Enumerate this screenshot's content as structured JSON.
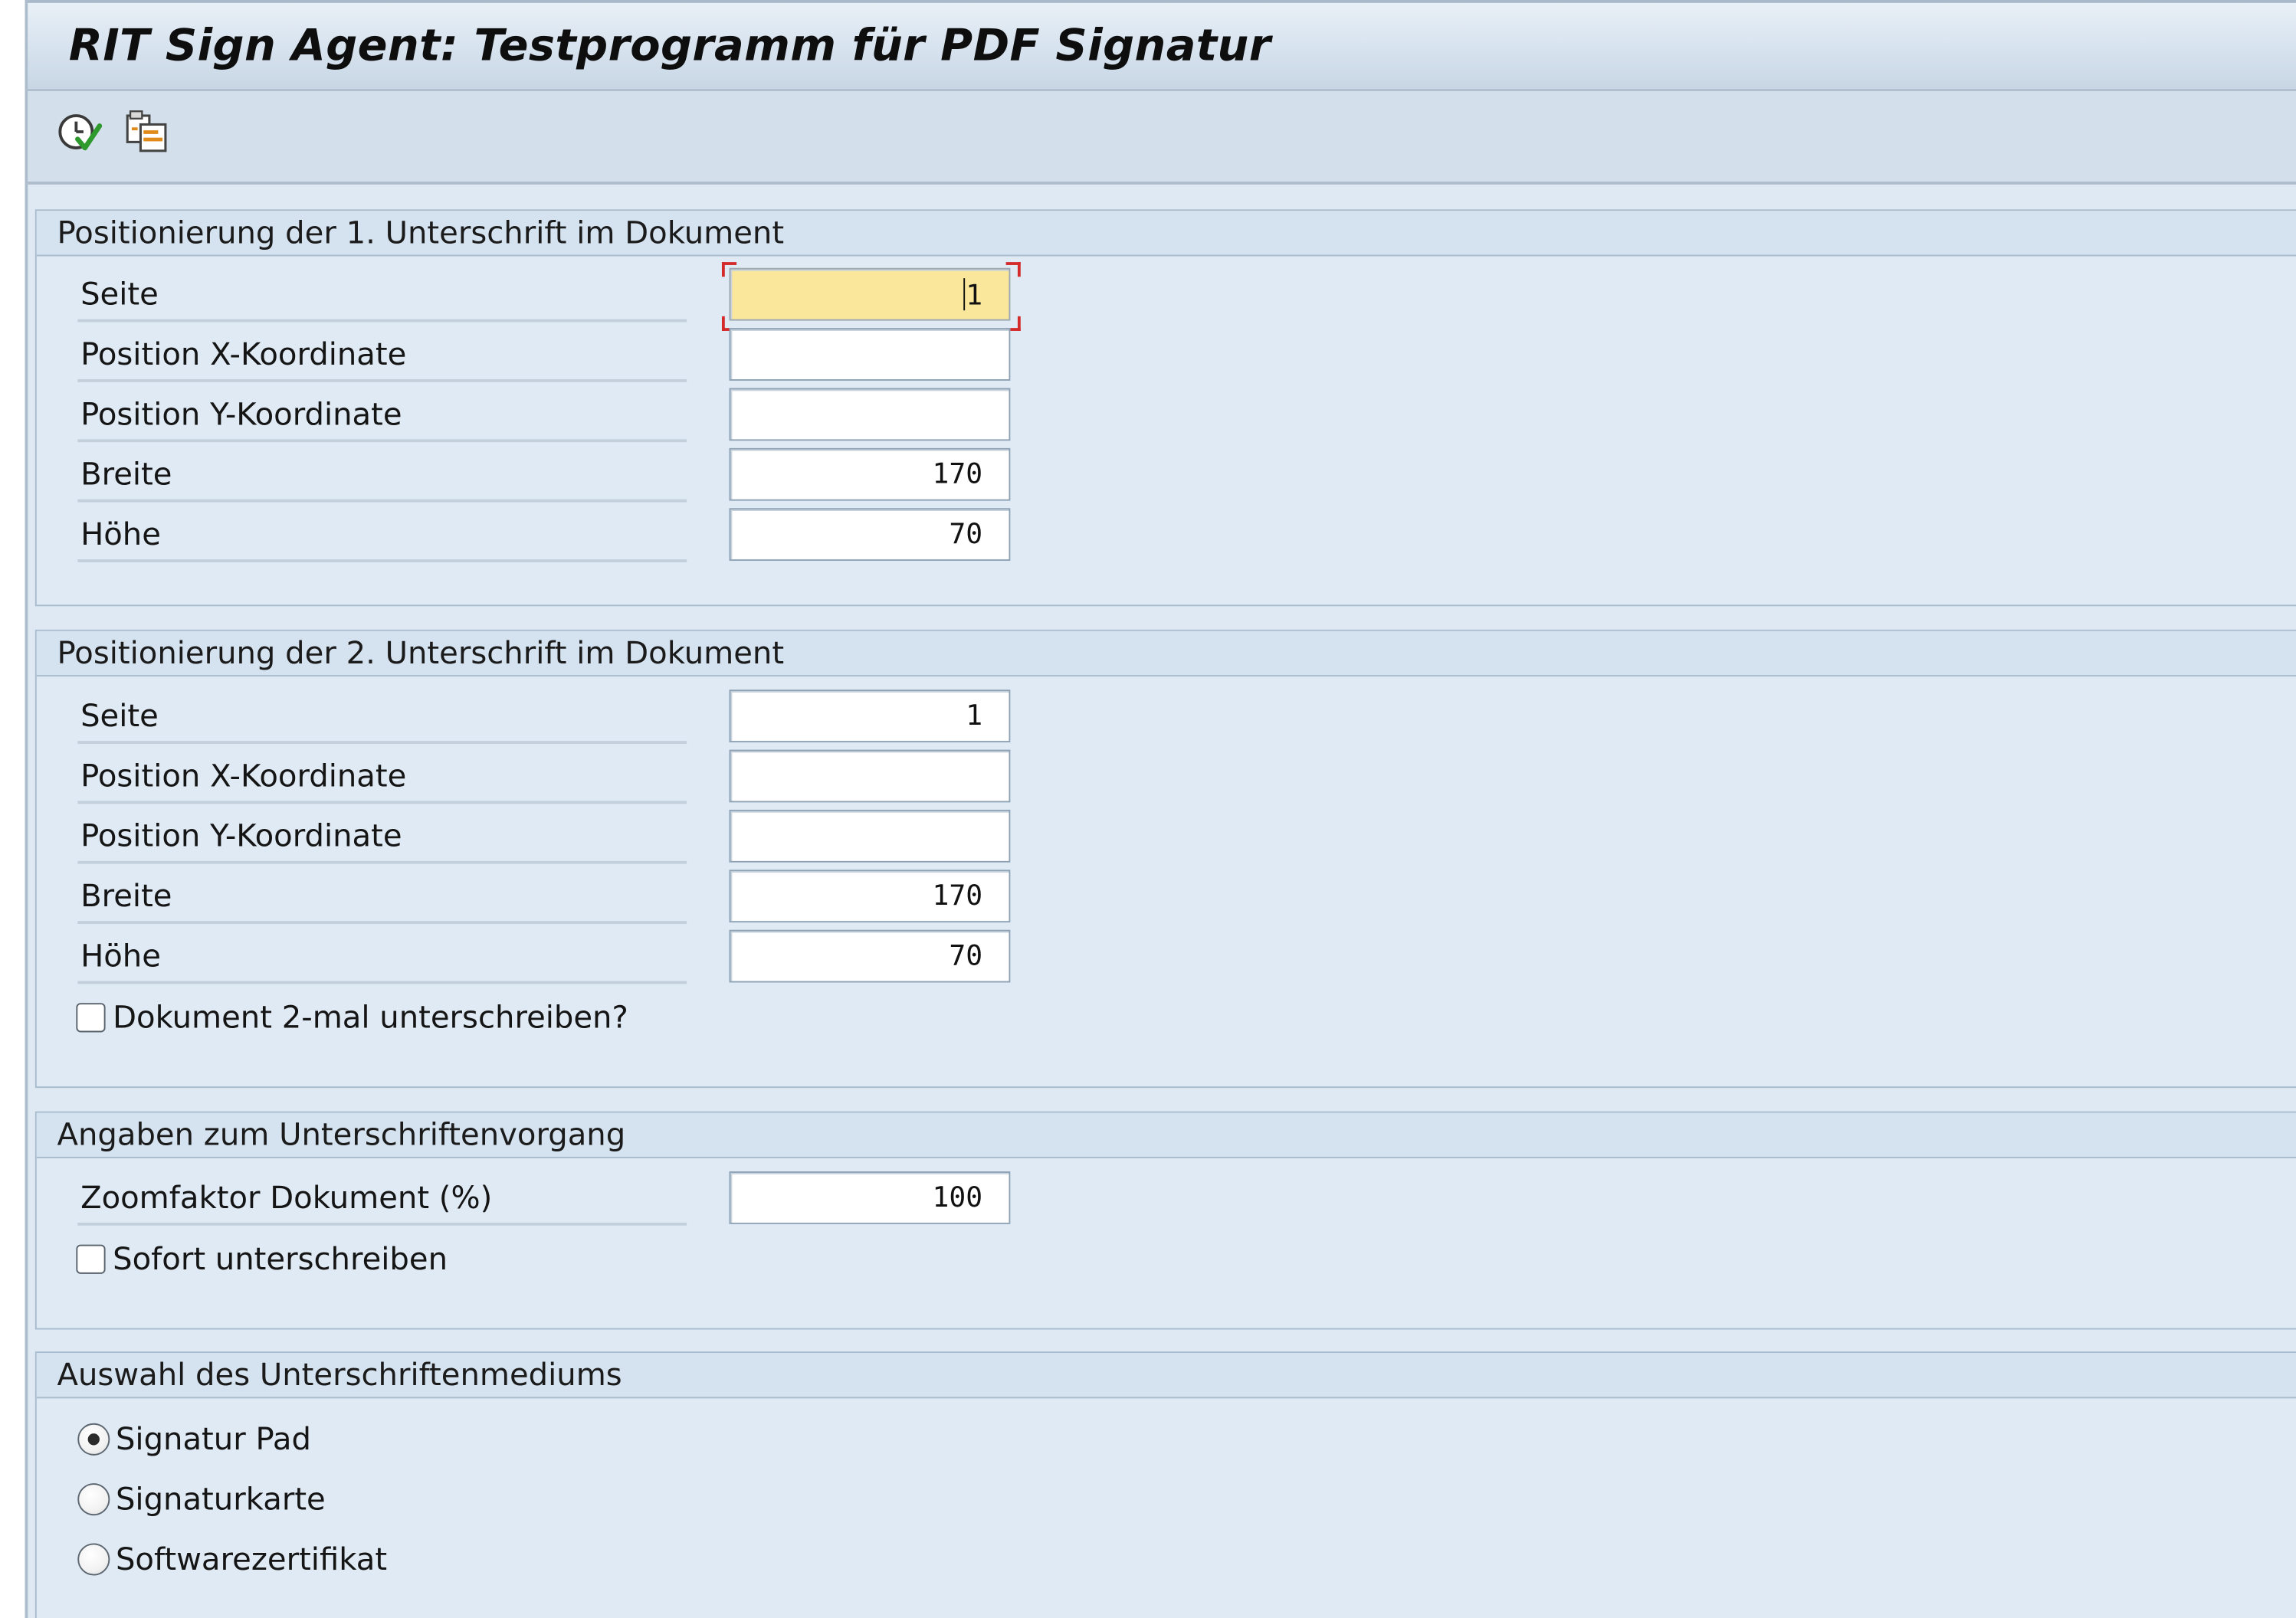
{
  "window": {
    "title": "RIT Sign Agent: Testprogramm für PDF Signatur"
  },
  "toolbar": {
    "execute_icon": "execute-clock-icon",
    "variants_icon": "copy-variant-icon"
  },
  "section1": {
    "title": "Positionierung der 1. Unterschrift im Dokument",
    "rows": [
      {
        "label": "Seite",
        "value": "1"
      },
      {
        "label": "Position X-Koordinate",
        "value": ""
      },
      {
        "label": "Position Y-Koordinate",
        "value": ""
      },
      {
        "label": "Breite",
        "value": "170"
      },
      {
        "label": "Höhe",
        "value": "70"
      }
    ]
  },
  "section2": {
    "title": "Positionierung der 2. Unterschrift im Dokument",
    "rows": [
      {
        "label": "Seite",
        "value": "1"
      },
      {
        "label": "Position X-Koordinate",
        "value": ""
      },
      {
        "label": "Position Y-Koordinate",
        "value": ""
      },
      {
        "label": "Breite",
        "value": "170"
      },
      {
        "label": "Höhe",
        "value": "70"
      }
    ],
    "checkbox_label": "Dokument 2-mal unterschreiben?",
    "checkbox_checked": false
  },
  "section3": {
    "title": "Angaben zum Unterschriftenvorgang",
    "zoom_label": "Zoomfaktor Dokument (%)",
    "zoom_value": "100",
    "checkbox_label": "Sofort unterschreiben",
    "checkbox_checked": false
  },
  "section4": {
    "title": "Auswahl des Unterschriftenmediums",
    "options": [
      {
        "label": "Signatur Pad",
        "selected": true
      },
      {
        "label": "Signaturkarte",
        "selected": false
      },
      {
        "label": "Softwarezertifikat",
        "selected": false
      }
    ]
  },
  "colors": {
    "focus_field": "#fbe79c",
    "focus_marker": "#d42a2a",
    "panel_background": "#dfeaf4"
  }
}
